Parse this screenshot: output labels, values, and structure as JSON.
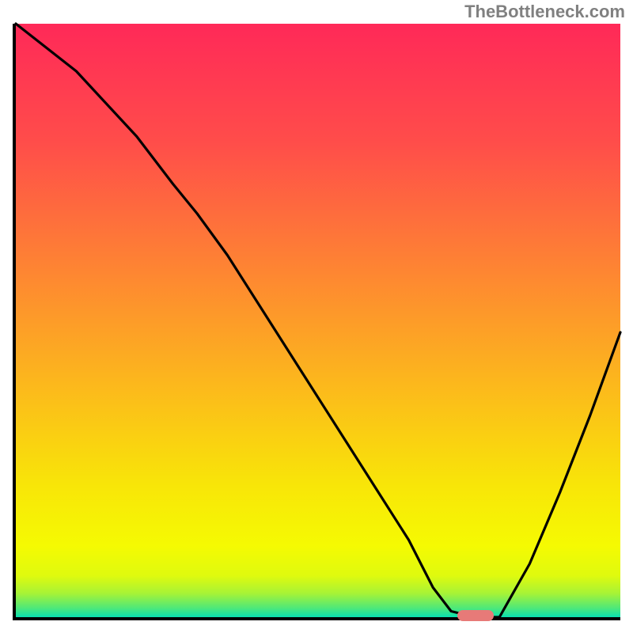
{
  "watermark": "TheBottleneck.com",
  "chart_data": {
    "type": "line",
    "title": "",
    "xlabel": "",
    "ylabel": "",
    "xlim": [
      0,
      100
    ],
    "ylim": [
      0,
      100
    ],
    "grid": false,
    "legend": false,
    "annotations": [],
    "background_gradient": {
      "stops": [
        {
          "offset": 0.0,
          "color": "#ff2958"
        },
        {
          "offset": 0.2,
          "color": "#ff4d4a"
        },
        {
          "offset": 0.4,
          "color": "#fe8134"
        },
        {
          "offset": 0.6,
          "color": "#fcb61d"
        },
        {
          "offset": 0.78,
          "color": "#f8e608"
        },
        {
          "offset": 0.88,
          "color": "#f5fa02"
        },
        {
          "offset": 0.93,
          "color": "#dffa0e"
        },
        {
          "offset": 0.96,
          "color": "#a7f336"
        },
        {
          "offset": 0.985,
          "color": "#4de87a"
        },
        {
          "offset": 1.0,
          "color": "#09e1b1"
        }
      ]
    },
    "series": [
      {
        "name": "bottleneck-curve",
        "color": "#000000",
        "x": [
          0,
          10,
          20,
          26,
          30,
          35,
          40,
          45,
          50,
          55,
          60,
          65,
          69,
          72,
          76,
          80,
          85,
          90,
          95,
          100
        ],
        "values": [
          100,
          92,
          81,
          73,
          68,
          61,
          53,
          45,
          37,
          29,
          21,
          13,
          5,
          1,
          0,
          0,
          9,
          21,
          34,
          48
        ]
      }
    ],
    "marker": {
      "name": "optimal-range",
      "x_start": 73,
      "x_end": 79,
      "y": 0,
      "color": "#e77a78"
    }
  }
}
